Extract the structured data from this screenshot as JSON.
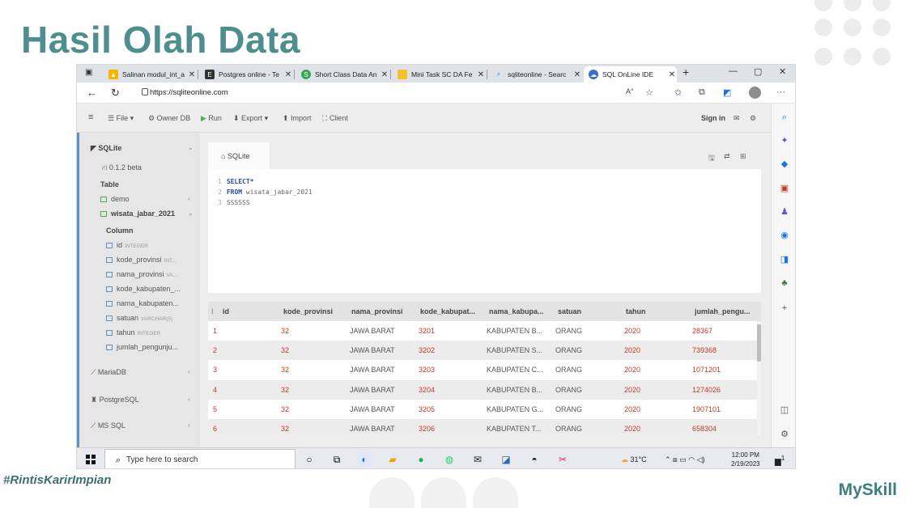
{
  "slide": {
    "title": "Hasil Olah Data",
    "hashtag": "#RintisKarirImpian",
    "brand": "MySkill"
  },
  "browser": {
    "tabs": [
      {
        "label": "Salinan modul_int_a",
        "icon": "drive-icon",
        "color": "#f4b400"
      },
      {
        "label": "Postgres online - Te",
        "icon": "e-icon",
        "color": "#333333"
      },
      {
        "label": "Short Class Data An",
        "icon": "s-icon",
        "color": "#34a853"
      },
      {
        "label": "Mini Task SC DA Fe",
        "icon": "doc-icon",
        "color": "#f6c026"
      },
      {
        "label": "sqliteonline - Searc",
        "icon": "search-icon",
        "color": "#1a73e8"
      },
      {
        "label": "SQL OnLine IDE",
        "icon": "cloud-icon",
        "color": "#3b6fc6"
      }
    ],
    "url": "https://sqliteonline.com"
  },
  "toolbar": {
    "file": "File",
    "owner": "Owner DB",
    "run": "Run",
    "export": "Export",
    "import": "Import",
    "client": "Client",
    "signin": "Sign in"
  },
  "sidebar": {
    "sqlite": "SQLite",
    "version": "0.1.2 beta",
    "table_header": "Table",
    "tables": [
      "demo",
      "wisata_jabar_2021"
    ],
    "column_header": "Column",
    "columns": [
      {
        "name": "id",
        "type": "INTEGER"
      },
      {
        "name": "kode_provinsi",
        "type": "INT..."
      },
      {
        "name": "nama_provinsi",
        "type": "VA..."
      },
      {
        "name": "kode_kabupaten_...",
        "type": ""
      },
      {
        "name": "nama_kabupaten...",
        "type": ""
      },
      {
        "name": "satuan",
        "type": "VARCHAR(5)"
      },
      {
        "name": "tahun",
        "type": "INTEGER"
      },
      {
        "name": "jumlah_pengunju...",
        "type": ""
      }
    ],
    "databases": [
      "MariaDB",
      "PostgreSQL",
      "MS SQL"
    ]
  },
  "editor": {
    "tab": "SQLite",
    "lines": [
      {
        "n": "1",
        "kw": "SELECT*",
        "rest": ""
      },
      {
        "n": "2",
        "kw": "FROM",
        "rest": " wisata_jabar_2021"
      },
      {
        "n": "3",
        "kw": "",
        "rest": "SSSSSS"
      }
    ]
  },
  "results": {
    "columns": [
      "id",
      "kode_provinsi",
      "nama_provinsi",
      "kode_kabupat...",
      "nama_kabupa...",
      "satuan",
      "tahun",
      "jumlah_pengu..."
    ],
    "rows": [
      [
        "1",
        "32",
        "JAWA BARAT",
        "3201",
        "KABUPATEN B...",
        "ORANG",
        "2020",
        "28367"
      ],
      [
        "2",
        "32",
        "JAWA BARAT",
        "3202",
        "KABUPATEN S...",
        "ORANG",
        "2020",
        "739368"
      ],
      [
        "3",
        "32",
        "JAWA BARAT",
        "3203",
        "KABUPATEN C...",
        "ORANG",
        "2020",
        "1071201"
      ],
      [
        "4",
        "32",
        "JAWA BARAT",
        "3204",
        "KABUPATEN B...",
        "ORANG",
        "2020",
        "1274026"
      ],
      [
        "5",
        "32",
        "JAWA BARAT",
        "3205",
        "KABUPATEN G...",
        "ORANG",
        "2020",
        "1907101"
      ],
      [
        "6",
        "32",
        "JAWA BARAT",
        "3206",
        "KABUPATEN T...",
        "ORANG",
        "2020",
        "658304"
      ]
    ]
  },
  "taskbar": {
    "search_placeholder": "Type here to search",
    "weather": "31°C",
    "time": "12:00 PM",
    "date": "2/19/2023",
    "notif": "1"
  }
}
